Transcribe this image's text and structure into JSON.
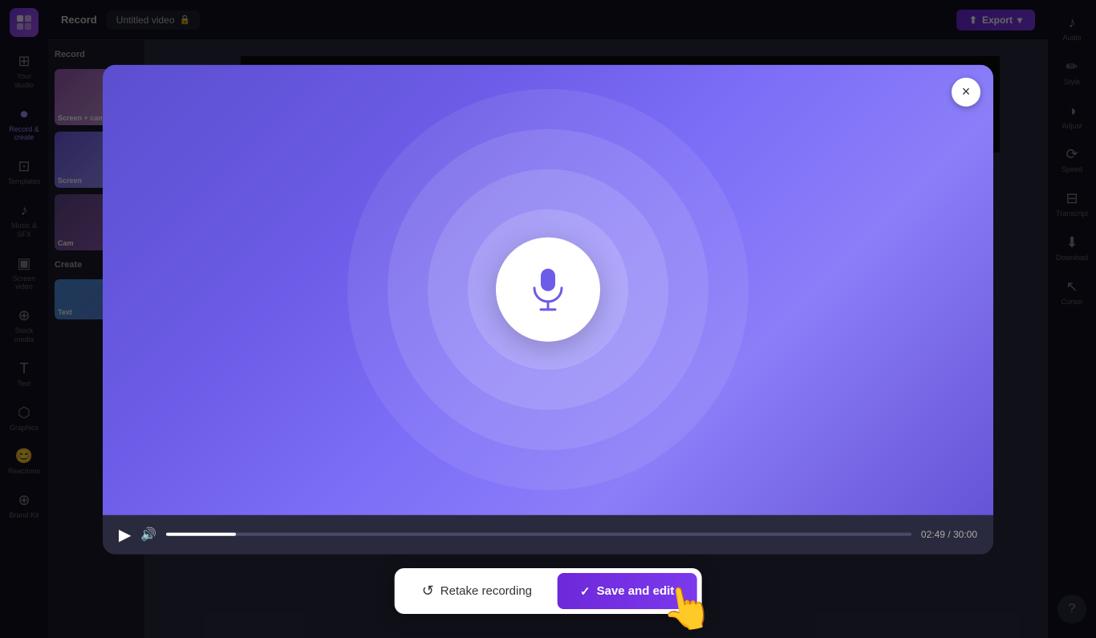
{
  "app": {
    "title": "Record",
    "tab_title": "Untitled video",
    "export_label": "Export"
  },
  "left_sidebar": {
    "items": [
      {
        "id": "your-studio",
        "label": "Your studio",
        "icon": "⊞"
      },
      {
        "id": "record-create",
        "label": "Record & create",
        "icon": "⏺"
      },
      {
        "id": "templates",
        "label": "Templates",
        "icon": "⊡"
      },
      {
        "id": "music-sfx",
        "label": "Music & SFX",
        "icon": "♪"
      },
      {
        "id": "screen-video",
        "label": "Screen video",
        "icon": "▣"
      },
      {
        "id": "stock-media",
        "label": "Stock media",
        "icon": "⊕"
      },
      {
        "id": "text",
        "label": "Text",
        "icon": "T"
      },
      {
        "id": "graphics",
        "label": "Graphics",
        "icon": "⬡"
      },
      {
        "id": "reactions",
        "label": "Reactions",
        "icon": "😊"
      },
      {
        "id": "brand-kit",
        "label": "Brand Kit",
        "icon": "⊕"
      }
    ]
  },
  "right_sidebar": {
    "items": [
      {
        "id": "audio",
        "label": "Audio",
        "icon": "♪"
      },
      {
        "id": "style",
        "label": "Style",
        "icon": "✏"
      },
      {
        "id": "adjust",
        "label": "Adjust",
        "icon": "◑"
      },
      {
        "id": "speed",
        "label": "Speed",
        "icon": "⟳"
      },
      {
        "id": "transcript",
        "label": "Transcript",
        "icon": "⊟"
      },
      {
        "id": "download",
        "label": "Download",
        "icon": "⬇"
      },
      {
        "id": "cursor",
        "label": "Cursor",
        "icon": "↖"
      }
    ]
  },
  "modal": {
    "close_label": "×",
    "video": {
      "mic_icon": "🎤",
      "background_color": "#6c5ce7"
    },
    "progress": {
      "current_time": "02:49",
      "total_time": "30:00",
      "progress_percent": 9.3
    },
    "buttons": {
      "retake_icon": "↺",
      "retake_label": "Retake recording",
      "save_icon": "✓",
      "save_label": "Save and edit"
    }
  },
  "thumbnails": [
    {
      "id": "screen-cam",
      "label": "Screen + cam"
    },
    {
      "id": "screen",
      "label": "Screen"
    },
    {
      "id": "cam",
      "label": "Cam"
    },
    {
      "id": "create",
      "label": "Create"
    },
    {
      "id": "text2",
      "label": "Text"
    }
  ]
}
